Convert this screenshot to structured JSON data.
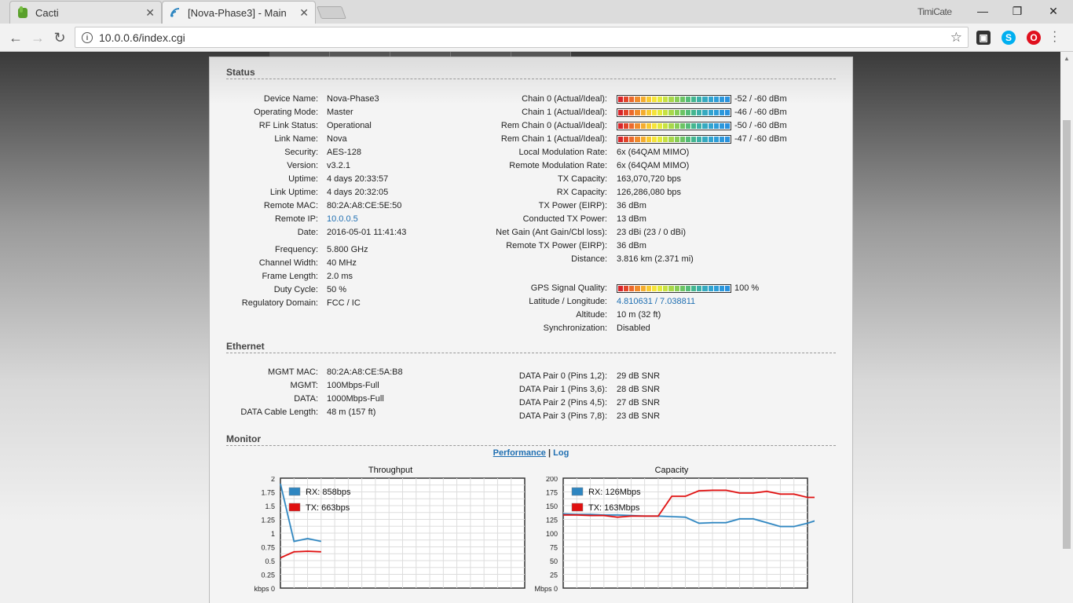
{
  "browser": {
    "tabs": [
      {
        "title": "Cacti",
        "active": false
      },
      {
        "title": "[Nova-Phase3] - Main",
        "active": true
      }
    ],
    "profile_name": "TimiCate",
    "url": "10.0.0.6/index.cgi"
  },
  "status": {
    "title": "Status",
    "left_rows": [
      {
        "label": "Device Name:",
        "value": "Nova-Phase3"
      },
      {
        "label": "Operating Mode:",
        "value": "Master"
      },
      {
        "label": "RF Link Status:",
        "value": "Operational"
      },
      {
        "label": "Link Name:",
        "value": "Nova"
      },
      {
        "label": "Security:",
        "value": "AES-128"
      },
      {
        "label": "Version:",
        "value": "v3.2.1"
      },
      {
        "label": "Uptime:",
        "value": "4 days 20:33:57"
      },
      {
        "label": "Link Uptime:",
        "value": "4 days 20:32:05"
      },
      {
        "label": "Remote MAC:",
        "value": "80:2A:A8:CE:5E:50"
      },
      {
        "label": "Remote IP:",
        "value": "10.0.0.5"
      },
      {
        "label": "Date:",
        "value": "2016-05-01 11:41:43"
      },
      {
        "label": "Frequency:",
        "value": "5.800 GHz"
      },
      {
        "label": "Channel Width:",
        "value": "40 MHz"
      },
      {
        "label": "Frame Length:",
        "value": "2.0 ms"
      },
      {
        "label": "Duty Cycle:",
        "value": "50 %"
      },
      {
        "label": "Regulatory Domain:",
        "value": "FCC / IC"
      }
    ],
    "right_rows": [
      {
        "label": "Chain 0 (Actual/Ideal):",
        "value": "-52 / -60 dBm",
        "meter": true
      },
      {
        "label": "Chain 1 (Actual/Ideal):",
        "value": "-46 / -60 dBm",
        "meter": true
      },
      {
        "label": "Rem Chain 0 (Actual/Ideal):",
        "value": "-50 / -60 dBm",
        "meter": true
      },
      {
        "label": "Rem Chain 1 (Actual/Ideal):",
        "value": "-47 / -60 dBm",
        "meter": true
      },
      {
        "label": "Local Modulation Rate:",
        "value": "6x (64QAM MIMO)"
      },
      {
        "label": "Remote Modulation Rate:",
        "value": "6x (64QAM MIMO)"
      },
      {
        "label": "TX Capacity:",
        "value": "163,070,720 bps"
      },
      {
        "label": "RX Capacity:",
        "value": "126,286,080 bps"
      },
      {
        "label": "TX Power (EIRP):",
        "value": "36 dBm"
      },
      {
        "label": "Conducted TX Power:",
        "value": "13 dBm"
      },
      {
        "label": "Net Gain (Ant Gain/Cbl loss):",
        "value": "23 dBi (23 / 0 dBi)"
      },
      {
        "label": "Remote TX Power (EIRP):",
        "value": "36 dBm"
      },
      {
        "label": "Distance:",
        "value": "3.816 km (2.371 mi)"
      },
      {
        "label": "GPS Signal Quality:",
        "value": "100 %",
        "meter": true
      },
      {
        "label": "Latitude / Longitude:",
        "value": "4.810631 / 7.038811"
      },
      {
        "label": "Altitude:",
        "value": "10 m (32 ft)"
      },
      {
        "label": "Synchronization:",
        "value": "Disabled"
      }
    ]
  },
  "ethernet": {
    "title": "Ethernet",
    "left_rows": [
      {
        "label": "MGMT MAC:",
        "value": "80:2A:A8:CE:5A:B8"
      },
      {
        "label": "MGMT:",
        "value": "100Mbps-Full"
      },
      {
        "label": "DATA:",
        "value": "1000Mbps-Full"
      },
      {
        "label": "DATA Cable Length:",
        "value": "48 m (157 ft)"
      }
    ],
    "right_rows": [
      {
        "label": "DATA Pair 0 (Pins 1,2):",
        "value": "29 dB SNR"
      },
      {
        "label": "DATA Pair 1 (Pins 3,6):",
        "value": "28 dB SNR"
      },
      {
        "label": "DATA Pair 2 (Pins 4,5):",
        "value": "27 dB SNR"
      },
      {
        "label": "DATA Pair 3 (Pins 7,8):",
        "value": "23 dB SNR"
      }
    ]
  },
  "monitor": {
    "title": "Monitor",
    "performance_link": "Performance",
    "separator": "|",
    "log_link": "Log"
  },
  "colors": {
    "rx": "#2e86c1",
    "tx": "#e01010",
    "link": "#1f6fb2"
  },
  "chart_data": [
    {
      "type": "line",
      "title": "Throughput",
      "unit_label": "kbps",
      "ylim": [
        0,
        2
      ],
      "yticks": [
        "0",
        "0.25",
        "0.5",
        "0.75",
        "1",
        "1.25",
        "1.5",
        "1.75",
        "2"
      ],
      "grid": true,
      "legend_placement": "top-left",
      "x_slots": 18,
      "series": [
        {
          "name": "RX: 858bps",
          "values": [
            1.9,
            0.85,
            0.9,
            0.85
          ]
        },
        {
          "name": "TX: 663bps",
          "values": [
            0.55,
            0.66,
            0.67,
            0.66
          ]
        }
      ]
    },
    {
      "type": "line",
      "title": "Capacity",
      "unit_label": "Mbps",
      "ylim": [
        0,
        200
      ],
      "yticks": [
        "0",
        "25",
        "50",
        "75",
        "100",
        "125",
        "150",
        "175",
        "200"
      ],
      "grid": true,
      "legend_placement": "top-left",
      "x_slots": 18,
      "series": [
        {
          "name": "RX: 126Mbps",
          "values": [
            135,
            134,
            134,
            133,
            133,
            132,
            131,
            131,
            130,
            129,
            118,
            119,
            119,
            126,
            126,
            119,
            112,
            112,
            118,
            126,
            126
          ]
        },
        {
          "name": "TX: 163Mbps",
          "values": [
            133,
            133,
            132,
            132,
            129,
            131,
            131,
            131,
            167,
            167,
            177,
            178,
            178,
            173,
            173,
            176,
            171,
            171,
            165,
            165,
            163
          ]
        }
      ]
    }
  ]
}
